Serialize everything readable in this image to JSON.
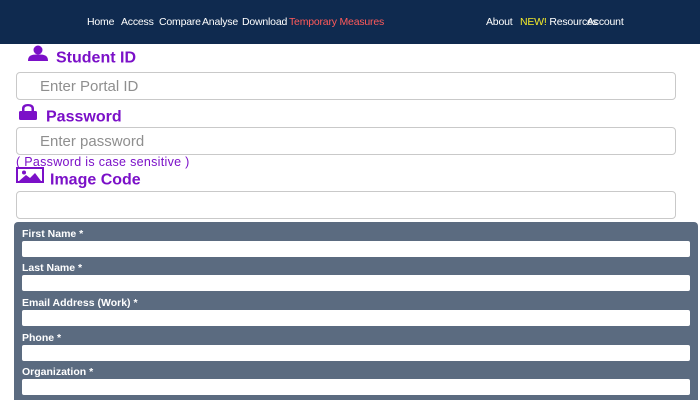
{
  "nav": {
    "left_items": [
      {
        "label": "Home"
      },
      {
        "label": "Access"
      },
      {
        "label": "Compare"
      },
      {
        "label": "Analyse"
      },
      {
        "label": "Download"
      },
      {
        "label": "Temporary Measures",
        "color": "#ff5a5a"
      }
    ],
    "right_items": [
      {
        "label": "About"
      },
      {
        "label_new": "NEW!",
        "label": " Resources",
        "new_color": "#f3ea2a"
      },
      {
        "label": "Account"
      }
    ],
    "background": "#0f2a4f"
  },
  "login": {
    "student_id": {
      "label": "Student ID",
      "icon": "user-icon",
      "placeholder": "Enter Portal ID"
    },
    "password": {
      "label": "Password",
      "icon": "lock-icon",
      "placeholder": "Enter password",
      "hint": "( Password is case sensitive )"
    },
    "image_code": {
      "label": "Image Code",
      "icon": "image-icon",
      "placeholder": ""
    },
    "accent_color": "#7b10c8"
  },
  "registration": {
    "background": "#5b6b80",
    "fields": [
      {
        "label": "First Name *"
      },
      {
        "label": "Last Name *"
      },
      {
        "label": "Email Address (Work) *"
      },
      {
        "label": "Phone *"
      },
      {
        "label": "Organization *"
      }
    ]
  }
}
